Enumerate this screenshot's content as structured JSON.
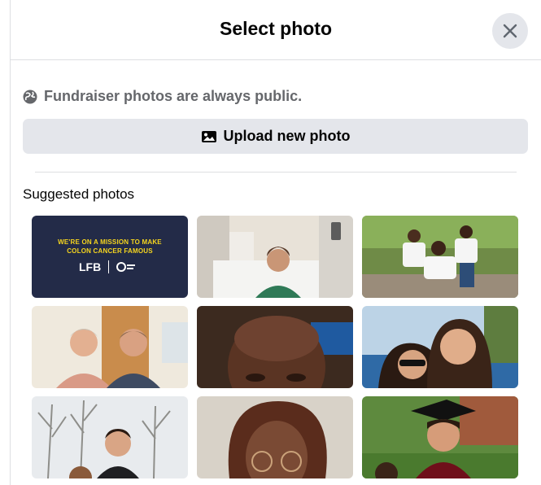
{
  "dialog": {
    "title": "Select photo",
    "close_icon": "close-icon"
  },
  "notice": {
    "icon": "globe-icon",
    "text": "Fundraiser photos are always public."
  },
  "upload": {
    "icon": "photo-icon",
    "label": "Upload new photo"
  },
  "suggested": {
    "title": "Suggested photos",
    "banner": {
      "line1": "WE'RE ON A MISSION TO MAKE",
      "line2": "COLON CANCER FAMOUS",
      "logo": "LFB"
    }
  },
  "colors": {
    "accent_gray": "#e4e6eb",
    "banner_navy": "#232b48",
    "banner_yellow": "#f6d51e"
  }
}
